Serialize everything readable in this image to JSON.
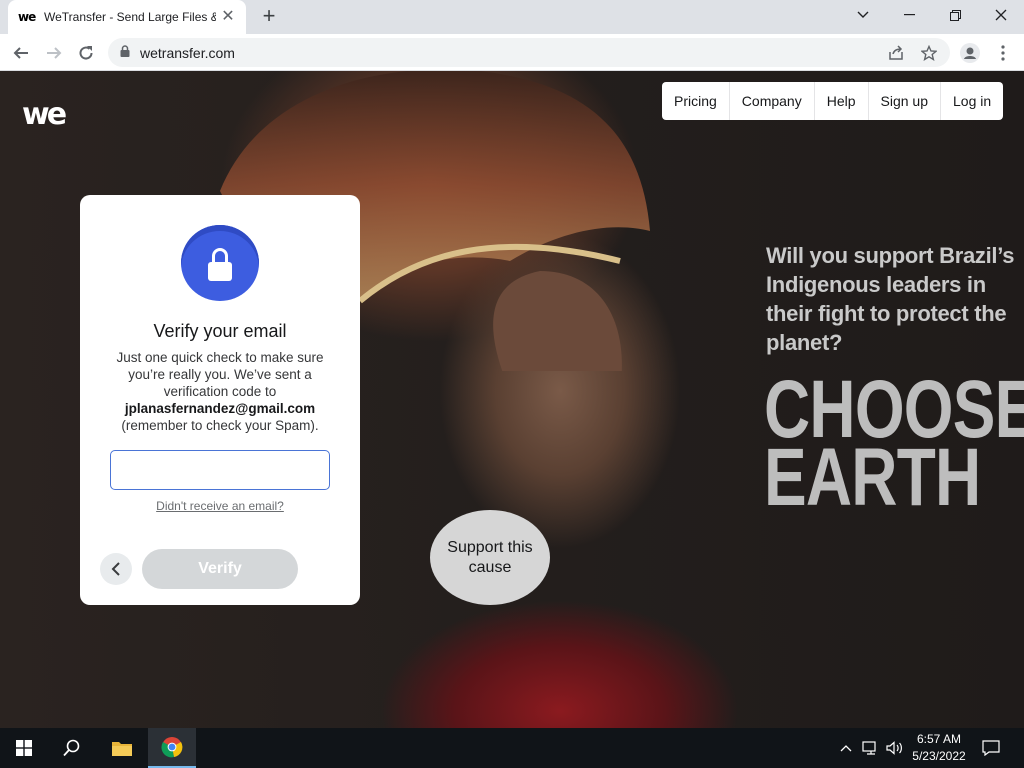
{
  "browser": {
    "tab_title": "WeTransfer - Send Large Files &",
    "tab_favicon": "we",
    "new_tab_symbol": "+",
    "url": "wetransfer.com"
  },
  "site": {
    "logo": "we",
    "nav": [
      "Pricing",
      "Company",
      "Help",
      "Sign up",
      "Log in"
    ]
  },
  "verify_card": {
    "title": "Verify your email",
    "text_before": "Just one quick check to make sure you’re really you. We’ve sent a verification code to",
    "email": "jplanasfernandez@gmail.com",
    "text_after": "(remember to check your Spam).",
    "code_value": "",
    "resend_link": "Didn't receive an email?",
    "verify_label": "Verify"
  },
  "support_button": "Support this cause",
  "promo": {
    "question": "Will you support Brazil’s Indigenous leaders in their fight to protect the planet?",
    "line1": "CHOOSE",
    "line2": "EARTH"
  },
  "taskbar": {
    "time": "6:57 AM",
    "date": "5/23/2022"
  },
  "colors": {
    "accent_blue": "#3d5de0",
    "input_border": "#4a74d6",
    "verify_disabled": "#d4d7d9"
  }
}
